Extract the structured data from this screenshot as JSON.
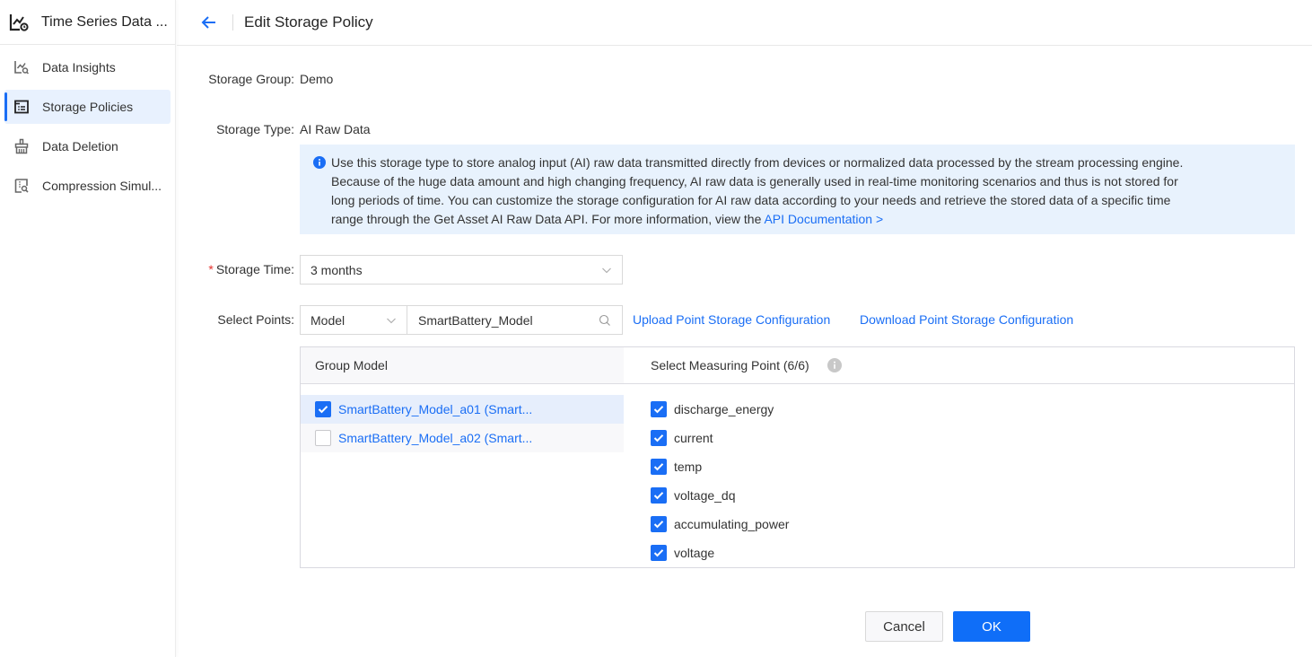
{
  "app": {
    "title": "Time Series Data ...",
    "accent_color": "#1a6ef5"
  },
  "sidebar": {
    "items": [
      {
        "label": "Data Insights",
        "icon": "chart-search-icon",
        "active": false
      },
      {
        "label": "Storage Policies",
        "icon": "list-folder-icon",
        "active": true
      },
      {
        "label": "Data Deletion",
        "icon": "broom-icon",
        "active": false
      },
      {
        "label": "Compression Simul...",
        "icon": "compression-doc-icon",
        "active": false
      }
    ]
  },
  "header": {
    "back_icon": "arrow-left-icon",
    "title": "Edit Storage Policy"
  },
  "form": {
    "storage_group": {
      "label": "Storage Group:",
      "value": "Demo"
    },
    "storage_type": {
      "label": "Storage Type:",
      "value": "AI Raw Data"
    },
    "info": {
      "icon": "info-circle-icon",
      "line1": "Use this storage type to store analog input (AI) raw data transmitted directly from devices or normalized data processed by the stream processing engine.",
      "line2": "Because of the huge data amount and high changing frequency, AI raw data is generally used in real-time monitoring scenarios and thus is not stored for",
      "line3": "long periods of time. You can customize the storage configuration for AI raw data according to your needs and retrieve the stored data of a specific time",
      "line4": "range through the Get Asset AI Raw Data API. For more information, view the ",
      "link": "API Documentation >"
    },
    "storage_time": {
      "required_mark": "*",
      "label": "Storage Time:",
      "value": "3 months"
    },
    "select_points": {
      "label": "Select Points:",
      "type_value": "Model",
      "search_value": "SmartBattery_Model",
      "upload_link": "Upload Point Storage Configuration",
      "download_link": "Download Point Storage Configuration"
    }
  },
  "transfer": {
    "left_header": "Group Model",
    "right_header": "Select Measuring Point (6/6)",
    "groups": [
      {
        "name": "SmartBattery_Model_a01 (Smart...",
        "checked": true
      },
      {
        "name": "SmartBattery_Model_a02 (Smart...",
        "checked": false
      }
    ],
    "points": [
      {
        "name": "discharge_energy",
        "checked": true
      },
      {
        "name": "current",
        "checked": true
      },
      {
        "name": "temp",
        "checked": true
      },
      {
        "name": "voltage_dq",
        "checked": true
      },
      {
        "name": "accumulating_power",
        "checked": true
      },
      {
        "name": "voltage",
        "checked": true
      }
    ]
  },
  "footer": {
    "cancel_label": "Cancel",
    "ok_label": "OK"
  }
}
